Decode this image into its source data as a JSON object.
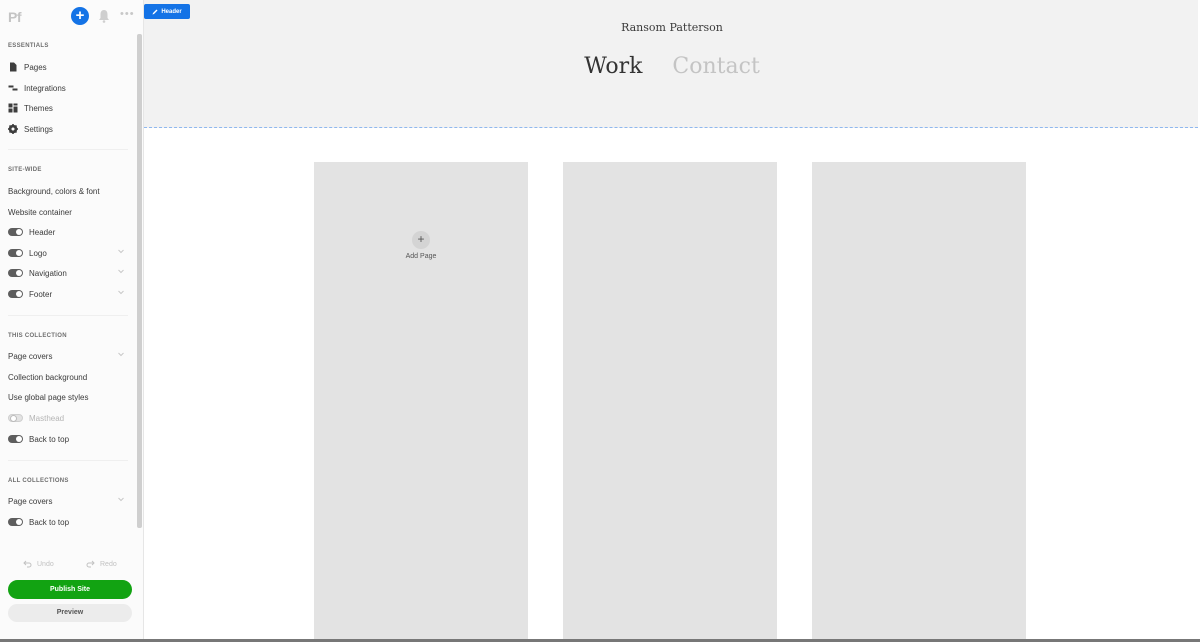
{
  "sidebar": {
    "logo": "Pf",
    "add_label": "+",
    "more_label": "•••",
    "sections": {
      "essentials": {
        "title": "Essentials",
        "items": [
          {
            "label": "Pages",
            "icon": "page-icon"
          },
          {
            "label": "Integrations",
            "icon": "integrations-icon"
          },
          {
            "label": "Themes",
            "icon": "themes-icon"
          },
          {
            "label": "Settings",
            "icon": "gear-icon"
          }
        ]
      },
      "site_wide": {
        "title": "Site-wide",
        "items": [
          {
            "label": "Background, colors & font"
          },
          {
            "label": "Website container"
          },
          {
            "label": "Header",
            "toggle": "on"
          },
          {
            "label": "Logo",
            "toggle": "on",
            "expandable": true
          },
          {
            "label": "Navigation",
            "toggle": "on",
            "expandable": true
          },
          {
            "label": "Footer",
            "toggle": "on",
            "expandable": true
          }
        ]
      },
      "this_collection": {
        "title": "This collection",
        "items": [
          {
            "label": "Page covers",
            "expandable": true
          },
          {
            "label": "Collection background"
          },
          {
            "label": "Use global page styles"
          },
          {
            "label": "Masthead",
            "toggle": "off",
            "disabled": true
          },
          {
            "label": "Back to top",
            "toggle": "on"
          }
        ]
      },
      "all_collections": {
        "title": "All collections",
        "items": [
          {
            "label": "Page covers",
            "expandable": true
          },
          {
            "label": "Back to top",
            "toggle": "on"
          }
        ]
      }
    },
    "undo_label": "Undo",
    "redo_label": "Redo",
    "publish_label": "Publish Site",
    "preview_label": "Preview"
  },
  "canvas": {
    "header_tag_label": "Header",
    "site_title": "Ransom Patterson",
    "nav": [
      {
        "label": "Work",
        "active": true
      },
      {
        "label": "Contact",
        "active": false
      }
    ],
    "add_page_label": "Add Page",
    "add_page_icon": "+"
  },
  "colors": {
    "accent": "#1473e6",
    "publish": "#12a312"
  }
}
